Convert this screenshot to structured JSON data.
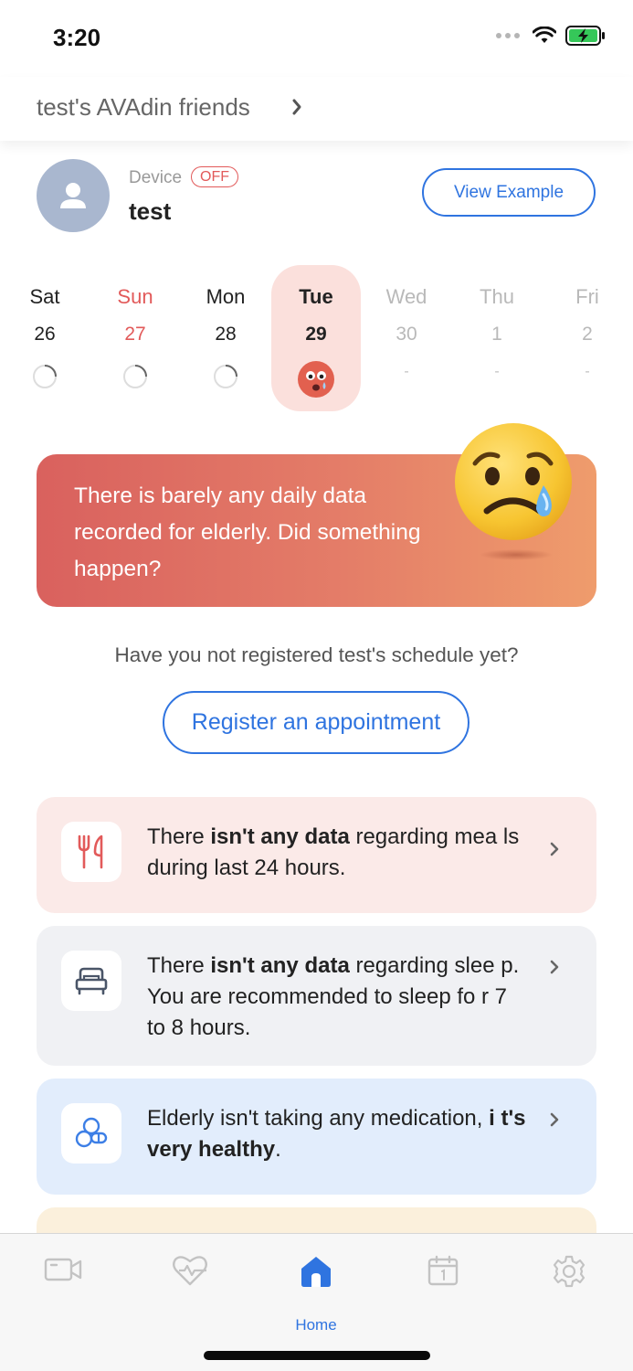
{
  "status_bar": {
    "time": "3:20"
  },
  "header": {
    "title": "test's AVAdin friends"
  },
  "profile": {
    "device_label": "Device",
    "device_status": "OFF",
    "name": "test",
    "view_example_label": "View Example"
  },
  "week": {
    "days": [
      {
        "name": "Sat",
        "date": "26",
        "marker": ""
      },
      {
        "name": "Sun",
        "date": "27",
        "marker": ""
      },
      {
        "name": "Mon",
        "date": "28",
        "marker": ""
      },
      {
        "name": "Tue",
        "date": "29",
        "marker": ""
      },
      {
        "name": "Wed",
        "date": "30",
        "marker": "-"
      },
      {
        "name": "Thu",
        "date": "1",
        "marker": "-"
      },
      {
        "name": "Fri",
        "date": "2",
        "marker": "-"
      }
    ]
  },
  "alert": {
    "text": "There is barely any daily data recorded for elderly. Did something happen?"
  },
  "schedule": {
    "question": "Have you not registered test's schedule yet?",
    "register_label": "Register an appointment"
  },
  "cards": {
    "meal": {
      "pre": "There ",
      "bold": "isn't any data",
      "post": " regarding mea ls during last 24 hours."
    },
    "sleep": {
      "pre": "There ",
      "bold": "isn't any data",
      "post": " regarding slee p. You are recommended to sleep fo r 7 to 8 hours."
    },
    "medication": {
      "pre": "Elderly isn't taking any medication, ",
      "bold": "i t's very healthy",
      "post": "."
    }
  },
  "tabbar": {
    "home_label": "Home"
  },
  "colors": {
    "accent": "#2f74e0",
    "sunday": "#e25a5a",
    "alert_start": "#d9615e",
    "alert_end": "#ef9c6c"
  }
}
